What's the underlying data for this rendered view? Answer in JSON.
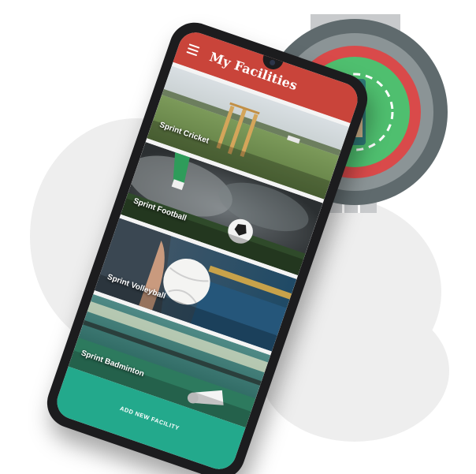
{
  "app": {
    "title": "My Facilities"
  },
  "facilities": [
    {
      "name": "Sprint Cricket"
    },
    {
      "name": "Sprint Football"
    },
    {
      "name": "Sprint Volleyball"
    },
    {
      "name": "Sprint Badminton"
    }
  ],
  "actions": {
    "add_facility_label": "ADD NEW FACILITY"
  },
  "theme": {
    "appbar_color": "#c9443a",
    "action_color": "#23a98c",
    "phone_frame_color": "#1c1c1e"
  },
  "icons": {
    "menu": "hamburger-menu-icon",
    "illustration": "cricket-stadium-icon"
  }
}
